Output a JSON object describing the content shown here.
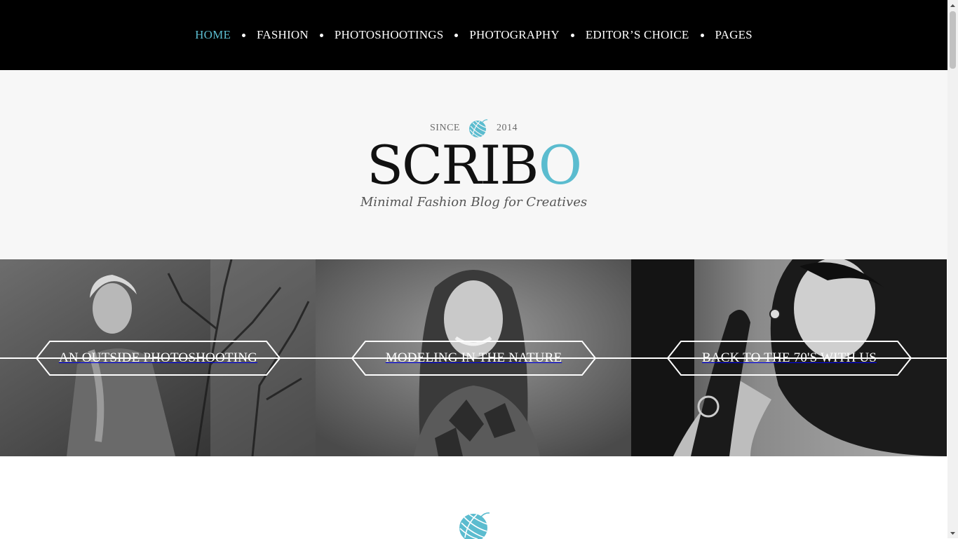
{
  "nav": {
    "items": [
      {
        "label": "HOME",
        "active": true
      },
      {
        "label": "FASHION",
        "active": false
      },
      {
        "label": "PHOTOSHOOTINGS",
        "active": false
      },
      {
        "label": "PHOTOGRAPHY",
        "active": false
      },
      {
        "label": "EDITOR’S CHOICE",
        "active": false
      },
      {
        "label": "PAGES",
        "active": false
      }
    ]
  },
  "header": {
    "since_label": "SINCE",
    "since_year": "2014",
    "logo_dark": "SCRIB",
    "logo_accent": "O",
    "tagline": "Minimal Fashion Blog for Creatives"
  },
  "slider": {
    "slides": [
      {
        "title": "AN OUTSIDE PHOTOSHOOTING"
      },
      {
        "title": "MODELING IN THE NATURE"
      },
      {
        "title": "BACK TO THE 70'S WITH US"
      }
    ]
  },
  "colors": {
    "accent": "#5bbccf",
    "nav_bg": "#000000",
    "header_bg": "#f7f7f7"
  },
  "icons": {
    "logo_mark": "yarn-ball-icon"
  }
}
